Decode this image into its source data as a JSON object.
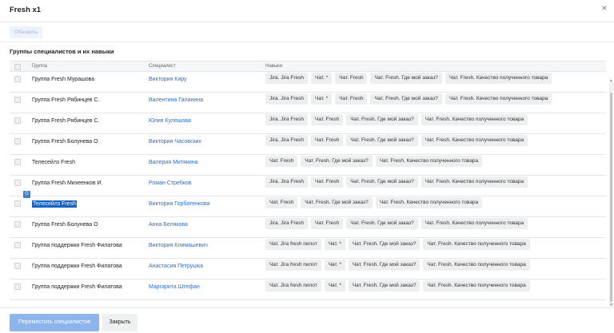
{
  "window": {
    "title": "Fresh x1",
    "close_glyph": "×"
  },
  "toolbar": {
    "refresh_label": "Обновить"
  },
  "section": {
    "title": "Группы специалистов и их навыки"
  },
  "table": {
    "headers": {
      "group": "Группа",
      "specialist": "Специалист",
      "skills": "Навыки"
    },
    "rows": [
      {
        "group": "Группа Fresh Мурашова",
        "specialist": "Виктория Киру",
        "skills": [
          "Jira. Jira Fresh",
          "Чат. *",
          "Чат. Fresh",
          "Чат. Fresh. Где мой заказ?",
          "Чат. Fresh. Качество полученного товара"
        ]
      },
      {
        "group": "Группа Fresh Рябинцев С.",
        "specialist": "Валентина Галанина",
        "skills": [
          "Jira. Jira Fresh",
          "Чат. *",
          "Чат. Fresh",
          "Чат. Fresh. Где мой заказ?",
          "Чат. Fresh. Качество полученного товара"
        ]
      },
      {
        "group": "Группа Fresh Рябинцев С.",
        "specialist": "Юлия Кулешова",
        "skills": [
          "Jira. Jira Fresh",
          "Чат. Fresh",
          "Чат. Fresh. Где мой заказ?",
          "Чат. Fresh. Качество полученного товара"
        ]
      },
      {
        "group": "Группа Fresh Болунева О",
        "specialist": "Виктория Часовских",
        "skills": [
          "Jira. Jira Fresh",
          "Чат. Fresh",
          "Чат. Fresh. Где мой заказ?",
          "Чат. Fresh. Качество полученного товара"
        ]
      },
      {
        "group": "Телесейлз Fresh",
        "specialist": "Валерия Митякина",
        "skills": [
          "Чат. Fresh",
          "Чат. Fresh. Где мой заказ?",
          "Чат. Fresh. Качество полученного товара"
        ]
      },
      {
        "group": "Группа Fresh Михеенков И.",
        "specialist": "Роман Стребков",
        "skills": [
          "Jira. Jira Fresh",
          "Чат. Fresh",
          "Чат. Fresh. Где мой заказ?",
          "Чат. Fresh. Качество полученного товара"
        ]
      },
      {
        "group": "Телесейлз Fresh",
        "specialist": "Виктория Горбатенкова",
        "skills": [
          "Чат. Fresh",
          "Чат. Fresh. Где мой заказ?",
          "Чат. Fresh. Качество полученного товара"
        ],
        "selected_text": true
      },
      {
        "group": "Группа Fresh Болунева О",
        "specialist": "Анна Белякова",
        "skills": [
          "Jira. Jira Fresh",
          "Чат. Fresh",
          "Чат. Fresh. Где мой заказ?",
          "Чат. Fresh. Качество полученного товара"
        ]
      },
      {
        "group": "Группа поддержки Fresh Филатова",
        "specialist": "Виктория Климашевич",
        "skills": [
          "Чат. Jira fresh пилот",
          "Чат. *",
          "Чат. Fresh. Где мой заказ?",
          "Чат. Fresh. Качество полученного товара"
        ]
      },
      {
        "group": "Группа поддержки Fresh Филатова",
        "specialist": "Анастасия Петрушка",
        "skills": [
          "Чат. Jira fresh пилот",
          "Чат. *",
          "Чат. Fresh. Где мой заказ?",
          "Чат. Fresh. Качество полученного товара"
        ]
      },
      {
        "group": "Группа поддержки Fresh Филатова",
        "specialist": "Маргарита Штефан",
        "skills": [
          "Чат. Jira fresh пилот",
          "Чат. *",
          "Чат. Fresh. Где мой заказ?",
          "Чат. Fresh. Качество полученного товара"
        ]
      }
    ]
  },
  "footer": {
    "move_label": "Переместить специалистов",
    "close_label": "Закрыть"
  },
  "colors": {
    "accent": "#2a6fcb",
    "primary_button": "#8eb4ec",
    "selection": "#1565c0",
    "tag_bg": "#eceef0"
  },
  "icons": {
    "close": "close-icon",
    "drag": "translate-icon",
    "checkbox": "checkbox-icon"
  }
}
